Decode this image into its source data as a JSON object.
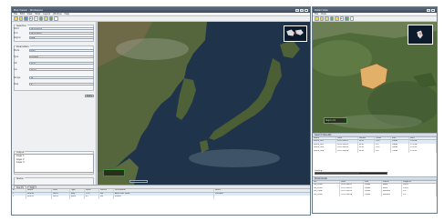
{
  "main_window": {
    "title": "Map Viewer - Workspace",
    "menu": [
      "File",
      "Edit",
      "View",
      "Tools",
      "Layers",
      "Window",
      "Help"
    ],
    "toolbar_icons": [
      "new-icon",
      "open-icon",
      "save-icon",
      "zoom-in-icon",
      "zoom-out-icon",
      "pan-icon",
      "refresh-icon",
      "layers-icon",
      "settings-icon"
    ]
  },
  "left_panel": {
    "section1": "Selection",
    "rows1": [
      {
        "label": "Start",
        "value": "2011-06-01"
      },
      {
        "label": "End",
        "value": "2011-06-07"
      },
      {
        "label": "Region",
        "value": "Asia"
      }
    ],
    "section2": "Parameters",
    "rows2": [
      {
        "label": "Mode",
        "value": "Auto"
      },
      {
        "label": "Type",
        "value": "Polygon"
      },
      {
        "label": "Lat",
        "value": "35.0"
      },
      {
        "label": "Lon",
        "value": "135.0"
      },
      {
        "label": "Range",
        "value": "10"
      },
      {
        "label": "Step",
        "value": "1"
      }
    ],
    "apply_label": "Apply",
    "section3": "Output",
    "list_items": [
      "Layer 1",
      "Layer 2",
      "Layer 3"
    ],
    "section4": "Status"
  },
  "bottom_panel": {
    "tabs": [
      "Results",
      "Log"
    ],
    "headers": [
      "ID",
      "Name",
      "Date",
      "Type",
      "Value",
      "Source",
      "Description",
      "Notes"
    ],
    "rows": [
      [
        "1",
        "Item A",
        "06-01",
        "poly",
        "12.5",
        "sat",
        "Area near coast",
        "checked"
      ],
      [
        "2",
        "Item B",
        "06-02",
        "point",
        "8.1",
        "sat",
        "Inland",
        ""
      ]
    ]
  },
  "side_window": {
    "title": "Detail View",
    "label_box": "Region 01",
    "table1_title": "Search Results",
    "table1_headers": [
      "Name",
      "Date",
      "Sensor",
      "Cloud",
      "Size",
      "Path"
    ],
    "table1_rows": [
      [
        "scene_001",
        "2011-06-01",
        "MOD",
        "10%",
        "25MB",
        "120/34"
      ],
      [
        "scene_002",
        "2011-06-02",
        "MOD",
        "5%",
        "24MB",
        "121/34"
      ],
      [
        "scene_003",
        "2011-06-03",
        "MOD",
        "20%",
        "26MB",
        "122/35"
      ],
      [
        "scene_004",
        "2011-06-04",
        "MOD",
        "0%",
        "23MB",
        "123/35"
      ]
    ],
    "progress_label": "Loading...",
    "progress": 0.62,
    "table2_title": "Downloads",
    "table2_headers": [
      "File",
      "Date",
      "Size",
      "Status",
      "Progress"
    ],
    "table2_rows": [
      [
        "file_a.hdf",
        "2011-06-01",
        "25MB",
        "done",
        "100%"
      ],
      [
        "file_b.hdf",
        "2011-06-02",
        "24MB",
        "done",
        "100%"
      ],
      [
        "file_c.hdf",
        "2011-06-03",
        "26MB",
        "queued",
        "0%"
      ],
      [
        "file_d.hdf",
        "2011-06-04",
        "23MB",
        "queued",
        "0%"
      ]
    ]
  },
  "colors": {
    "titlebar": "#4b5a6b",
    "ocean": "#1e3247",
    "land": "#5a6b3f",
    "highlight": "#e8b36a"
  }
}
